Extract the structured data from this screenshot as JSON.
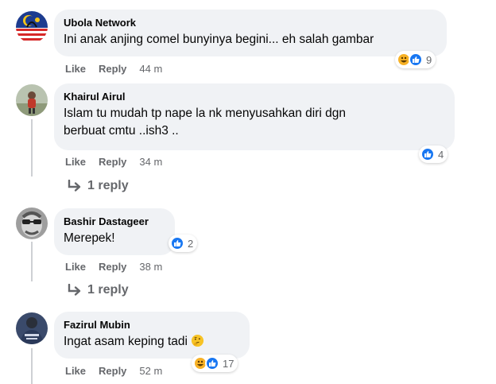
{
  "comments": [
    {
      "author": "Ubola Network",
      "text": "Ini anak anjing comel bunyinya begini... eh salah gambar",
      "like_label": "Like",
      "reply_label": "Reply",
      "time": "44 m",
      "reaction_icons": [
        "haha-icon",
        "like-icon"
      ],
      "reaction_count": "9"
    },
    {
      "author": "Khairul Airul",
      "text": "Islam tu mudah tp nape la nk menyusahkan diri dgn\nberbuat cmtu ..ish3 ..",
      "like_label": "Like",
      "reply_label": "Reply",
      "time": "34 m",
      "reaction_icons": [
        "like-icon"
      ],
      "reaction_count": "4",
      "view_replies": "1 reply"
    },
    {
      "author": "Bashir Dastageer",
      "text": "Merepek!",
      "like_label": "Like",
      "reply_label": "Reply",
      "time": "38 m",
      "reaction_icons": [
        "like-icon"
      ],
      "reaction_count": "2",
      "view_replies": "1 reply"
    },
    {
      "author": "Fazirul Mubin",
      "text": "Ingat asam keping tadi",
      "text_emoji": "thinking-face-emoji",
      "like_label": "Like",
      "reply_label": "Reply",
      "time": "52 m",
      "reaction_icons": [
        "haha-icon",
        "like-icon"
      ],
      "reaction_count": "17"
    }
  ],
  "colors": {
    "bubble": "#f0f2f5",
    "meta_text": "#65676b",
    "like_blue": "#1877f2",
    "haha_yellow": "#f7b125",
    "thread_line": "#ced0d4"
  }
}
